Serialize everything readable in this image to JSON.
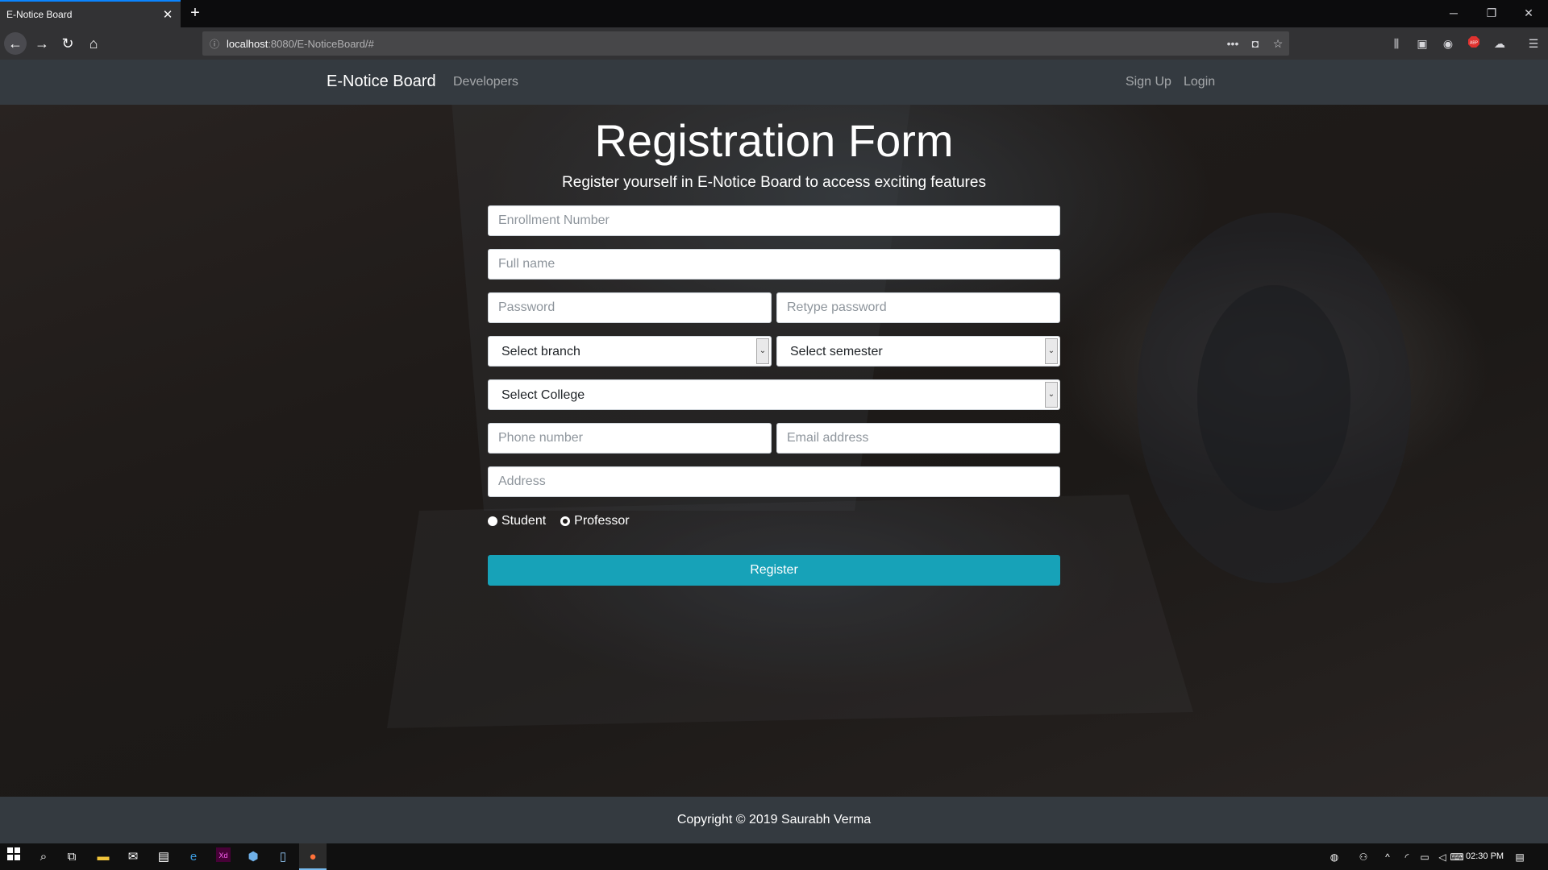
{
  "browser": {
    "tab_title": "E-Notice Board",
    "url_host": "localhost",
    "url_rest": ":8080/E-NoticeBoard/#"
  },
  "site": {
    "brand": "E-Notice Board",
    "nav_left": [
      "Developers"
    ],
    "nav_right": [
      "Sign Up",
      "Login"
    ]
  },
  "form": {
    "title": "Registration Form",
    "subtitle": "Register yourself in E-Notice Board to access exciting features",
    "placeholders": {
      "enrollment": "Enrollment Number",
      "fullname": "Full name",
      "password": "Password",
      "retype": "Retype password",
      "phone": "Phone number",
      "email": "Email address",
      "address": "Address"
    },
    "selects": {
      "branch": "Select branch",
      "semester": "Select semester",
      "college": "Select College"
    },
    "roles": [
      "Student",
      "Professor"
    ],
    "register_label": "Register"
  },
  "footer": {
    "copyright": "Copyright © 2019 Saurabh Verma"
  },
  "taskbar": {
    "clock": "02:30 PM"
  }
}
